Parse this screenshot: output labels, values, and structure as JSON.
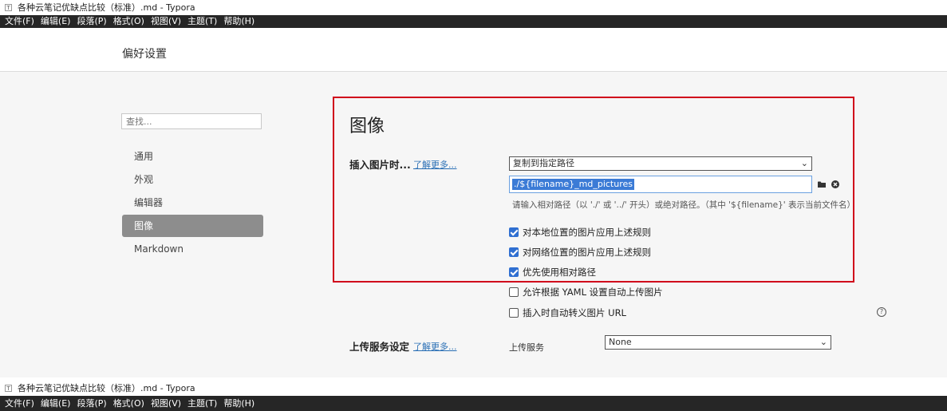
{
  "window": {
    "title": "各种云笔记优缺点比较（标准）.md - Typora",
    "app_icon_glyph": "T"
  },
  "menu": {
    "items": [
      "文件(F)",
      "编辑(E)",
      "段落(P)",
      "格式(O)",
      "视图(V)",
      "主题(T)",
      "帮助(H)"
    ]
  },
  "prefs": {
    "title": "偏好设置",
    "search_placeholder": "查找...",
    "nav": [
      {
        "label": "通用",
        "active": false
      },
      {
        "label": "外观",
        "active": false
      },
      {
        "label": "编辑器",
        "active": false
      },
      {
        "label": "图像",
        "active": true
      },
      {
        "label": "Markdown",
        "active": false
      }
    ]
  },
  "image_section": {
    "title": "图像",
    "insert_label": "插入图片时...",
    "learn_more": "了解更多...",
    "insert_action": "复制到指定路径",
    "path_value": "./${filename}_md_pictures",
    "path_hint": "请输入相对路径（以 './' 或 '../' 开头）或绝对路径。（其中 '${filename}' 表示当前文件名）",
    "checkboxes": [
      {
        "label": "对本地位置的图片应用上述规则",
        "checked": true
      },
      {
        "label": "对网络位置的图片应用上述规则",
        "checked": true
      },
      {
        "label": "优先使用相对路径",
        "checked": true
      },
      {
        "label": "允许根据 YAML 设置自动上传图片",
        "checked": false
      },
      {
        "label": "插入时自动转义图片 URL",
        "checked": false
      }
    ],
    "upload_label": "上传服务设定",
    "upload_learn_more": "了解更多...",
    "upload_service_label": "上传服务",
    "upload_service_value": "None"
  },
  "colors": {
    "menubar_bg": "#262626",
    "accent": "#2f6fd1",
    "highlight_box": "#d0021b",
    "active_nav": "#8d8d8d"
  },
  "icons": [
    "folder-icon",
    "clear-icon",
    "help-icon",
    "chevron-down-icon"
  ]
}
